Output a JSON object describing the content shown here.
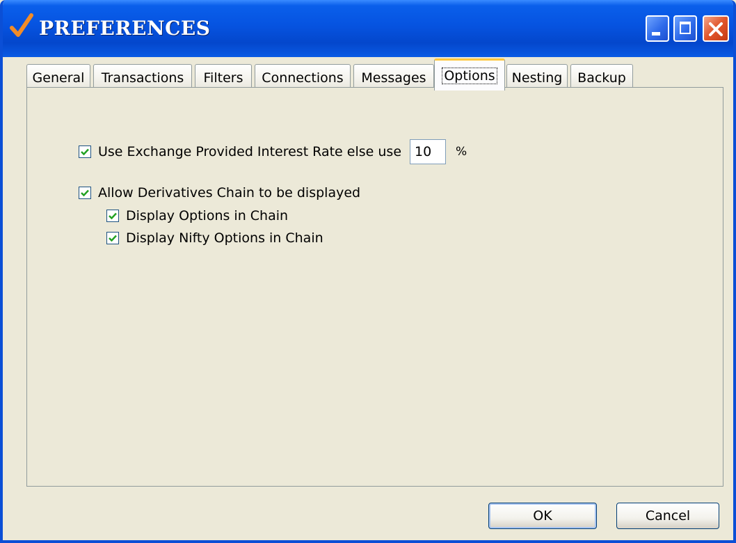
{
  "window": {
    "title": "PREFERENCES",
    "app_icon": "checkmark-icon",
    "controls": {
      "minimize": "minimize-icon",
      "maximize": "maximize-icon",
      "close": "close-icon"
    }
  },
  "tabs": [
    {
      "label": "General",
      "active": false
    },
    {
      "label": "Transactions",
      "active": false
    },
    {
      "label": "Filters",
      "active": false
    },
    {
      "label": "Connections",
      "active": false
    },
    {
      "label": "Messages",
      "active": false
    },
    {
      "label": "Options",
      "active": true
    },
    {
      "label": "Nesting",
      "active": false
    },
    {
      "label": "Backup",
      "active": false
    }
  ],
  "options": {
    "interest_rate": {
      "label": "Use Exchange Provided Interest Rate  else use",
      "checked": true,
      "value": "10",
      "unit": "%"
    },
    "derivatives_chain": {
      "label": "Allow Derivatives Chain to be displayed",
      "checked": true
    },
    "display_options": {
      "label": "Display Options in Chain",
      "checked": true
    },
    "display_nifty": {
      "label": "Display Nifty Options in Chain",
      "checked": true
    }
  },
  "buttons": {
    "ok": "OK",
    "cancel": "Cancel"
  },
  "colors": {
    "titlebar": "#0653E0",
    "check": "#21A121",
    "active_tab_accent": "#FFC73C",
    "close_button": "#E1552A"
  }
}
